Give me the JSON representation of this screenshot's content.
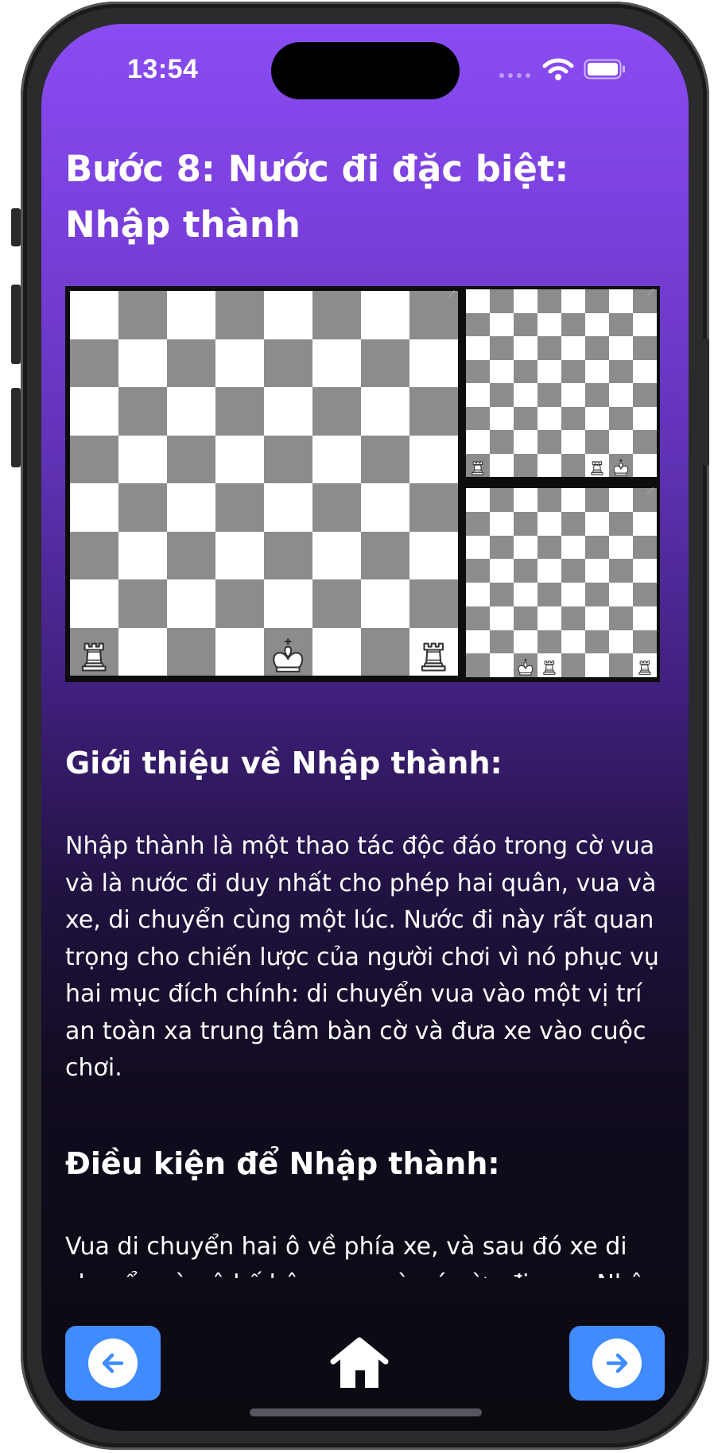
{
  "status_bar": {
    "time": "13:54"
  },
  "lesson": {
    "title": "Bước 8: Nước đi đặc biệt: Nhập thành",
    "sections": [
      {
        "heading": "Giới thiệu về Nhập thành:",
        "body": "Nhập thành là một thao tác độc đáo trong cờ vua và là nước đi duy nhất cho phép hai quân, vua và xe, di chuyển cùng một lúc. Nước đi này rất quan trọng cho chiến lược của người chơi vì nó phục vụ hai mục đích chính: di chuyển vua vào một vị trí an toàn xa trung tâm bàn cờ và đưa xe vào cuộc chơi."
      },
      {
        "heading": "Điều kiện để Nhập thành:",
        "body": "Vua di chuyển hai ô về phía xe, và sau đó xe di chuyển vào ô kế bên vua mà nó vừa đi qua. Nhập"
      }
    ]
  },
  "diagrams": {
    "main": {
      "pieces": [
        {
          "square": "a1",
          "piece": "white-rook"
        },
        {
          "square": "e1",
          "piece": "white-king"
        },
        {
          "square": "h1",
          "piece": "white-rook"
        }
      ]
    },
    "kingside": {
      "pieces": [
        {
          "square": "a1",
          "piece": "white-rook"
        },
        {
          "square": "f1",
          "piece": "white-rook"
        },
        {
          "square": "g1",
          "piece": "white-king"
        }
      ]
    },
    "queenside": {
      "pieces": [
        {
          "square": "c1",
          "piece": "white-king"
        },
        {
          "square": "d1",
          "piece": "white-rook"
        },
        {
          "square": "h1",
          "piece": "white-rook"
        }
      ]
    }
  },
  "navigation": {
    "back_icon": "arrow-left-icon",
    "home_icon": "home-icon",
    "next_icon": "arrow-right-icon",
    "button_color": "#3f8bff"
  },
  "colors": {
    "gradient_top": "#8a4cf3",
    "gradient_bottom": "#0b0a10",
    "board_light": "#ffffff",
    "board_dark": "#8c8c8c"
  }
}
